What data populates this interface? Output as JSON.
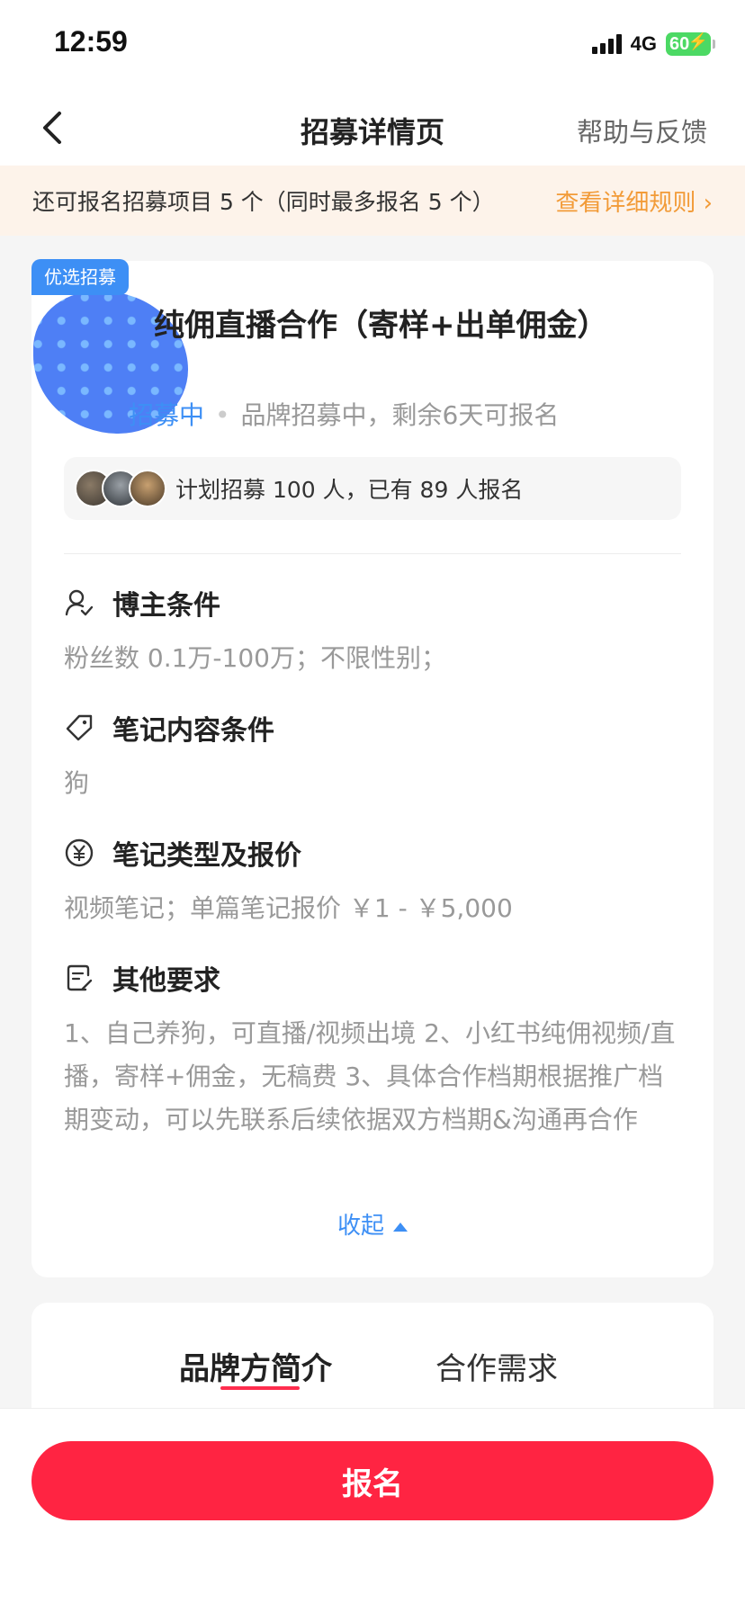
{
  "status_bar": {
    "time": "12:59",
    "network": "4G",
    "battery": "60"
  },
  "nav": {
    "title": "招募详情页",
    "help": "帮助与反馈"
  },
  "notice": {
    "text": "还可报名招募项目 5 个（同时最多报名 5 个）",
    "link": "查看详细规则 ›"
  },
  "recruit": {
    "tag": "优选招募",
    "title": "纯佣直播合作（寄样+出单佣金）",
    "status_blue": "招募中",
    "status_text": "品牌招募中，剩余6天可报名",
    "signup_summary": "计划招募 100 人，已有 89 人报名"
  },
  "sections": {
    "blogger": {
      "title": "博主条件",
      "body": "粉丝数 0.1万-100万；不限性别；"
    },
    "note_content": {
      "title": "笔记内容条件",
      "body": "狗"
    },
    "note_type": {
      "title": "笔记类型及报价",
      "body": "视频笔记；单篇笔记报价 ￥1 - ￥5,000"
    },
    "other": {
      "title": "其他要求",
      "body": "1、自己养狗，可直播/视频出境 2、小红书纯佣视频/直播，寄样+佣金，无稿费 3、具体合作档期根据推广档期变动，可以先联系后续依据双方档期&沟通再合作"
    }
  },
  "collapse_label": "收起",
  "tabs": {
    "brand": "品牌方简介",
    "needs": "合作需求"
  },
  "cta": {
    "label": "报名"
  },
  "colors": {
    "accent": "#ff2442",
    "link_blue": "#3d8ff5",
    "notice_orange": "#f29b38"
  }
}
